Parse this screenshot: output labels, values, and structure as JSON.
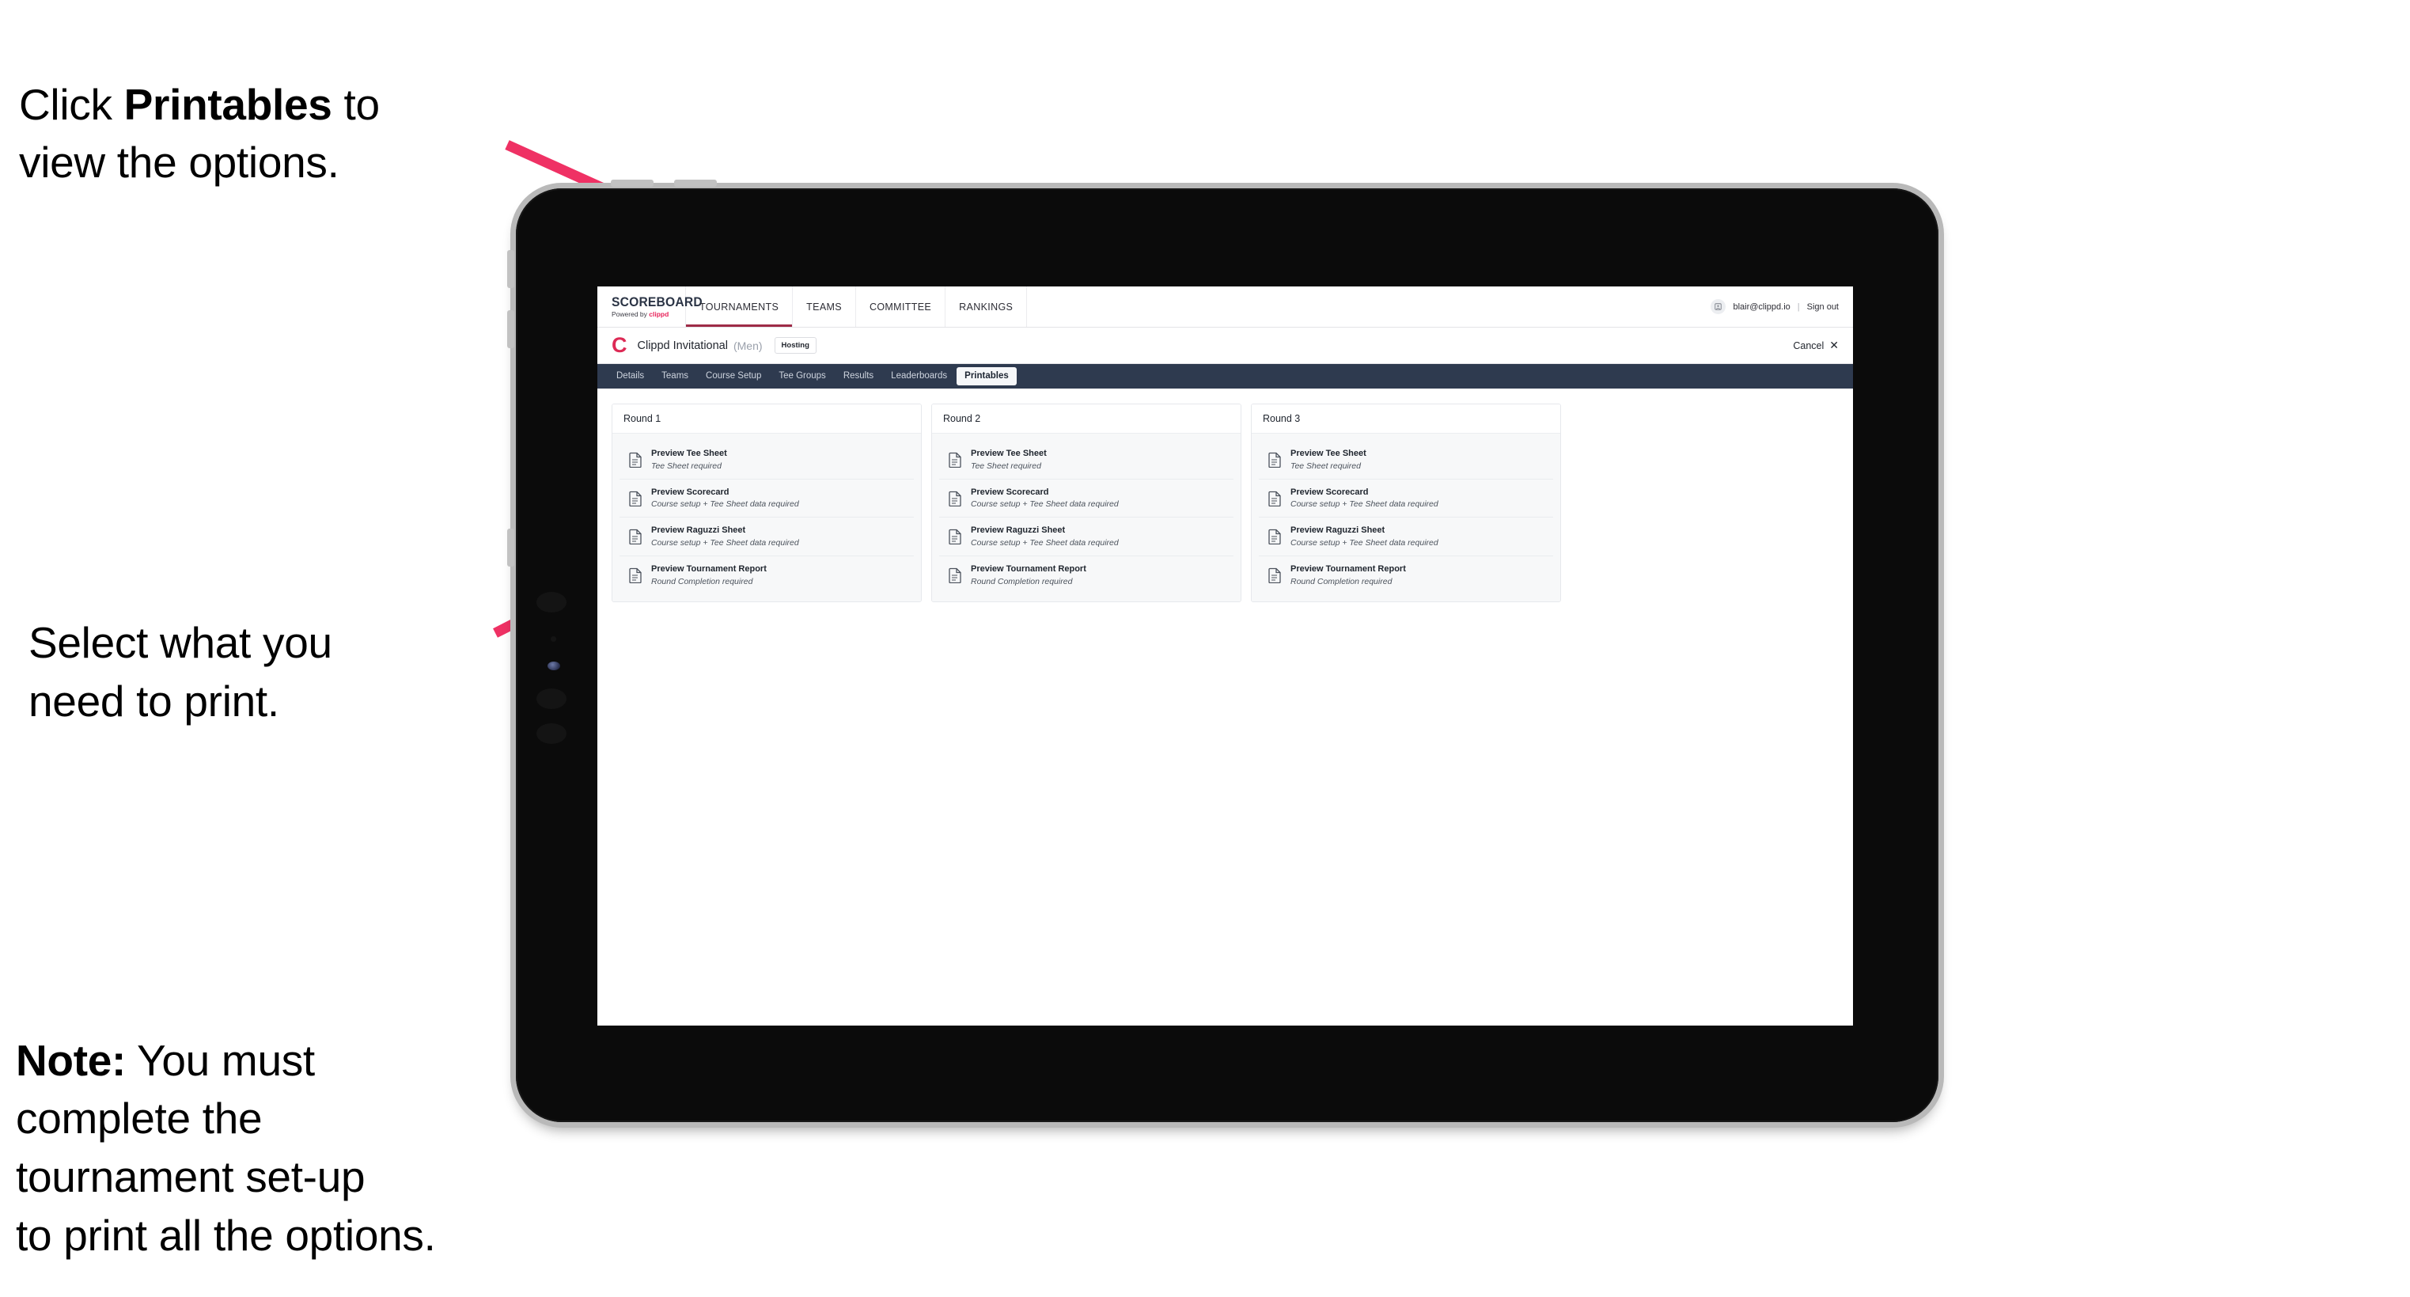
{
  "annotations": {
    "top": {
      "prefix": "Click ",
      "bold": "Printables",
      "suffix": " to\nview the options."
    },
    "middle": {
      "text": "Select what you\n need to print."
    },
    "note": {
      "bold": "Note:",
      "text": " You must\ncomplete the\ntournament set-up\nto print all the options."
    }
  },
  "app": {
    "global_nav": {
      "brand_title": "SCOREBOARD",
      "brand_sub_prefix": "Powered by ",
      "brand_sub_highlight": "clippd",
      "items": [
        {
          "label": "TOURNAMENTS",
          "active": true
        },
        {
          "label": "TEAMS",
          "active": false
        },
        {
          "label": "COMMITTEE",
          "active": false
        },
        {
          "label": "RANKINGS",
          "active": false
        }
      ],
      "avatar_icon": "user-avatar-icon",
      "user_email": "blair@clippd.io",
      "separator": "|",
      "sign_out": "Sign out"
    },
    "tournament_bar": {
      "logo_letter": "C",
      "name": "Clippd Invitational",
      "gender": "(Men)",
      "badge": "Hosting",
      "cancel_label": "Cancel",
      "cancel_icon": "✕"
    },
    "tabs": [
      {
        "label": "Details",
        "active": false
      },
      {
        "label": "Teams",
        "active": false
      },
      {
        "label": "Course Setup",
        "active": false
      },
      {
        "label": "Tee Groups",
        "active": false
      },
      {
        "label": "Results",
        "active": false
      },
      {
        "label": "Leaderboards",
        "active": false
      },
      {
        "label": "Printables",
        "active": true
      }
    ],
    "rounds": [
      {
        "header": "Round 1",
        "items": [
          {
            "title": "Preview Tee Sheet",
            "sub": "Tee Sheet required"
          },
          {
            "title": "Preview Scorecard",
            "sub": "Course setup + Tee Sheet data required"
          },
          {
            "title": "Preview Raguzzi Sheet",
            "sub": "Course setup + Tee Sheet data required"
          },
          {
            "title": "Preview Tournament Report",
            "sub": "Round Completion required"
          }
        ]
      },
      {
        "header": "Round 2",
        "items": [
          {
            "title": "Preview Tee Sheet",
            "sub": "Tee Sheet required"
          },
          {
            "title": "Preview Scorecard",
            "sub": "Course setup + Tee Sheet data required"
          },
          {
            "title": "Preview Raguzzi Sheet",
            "sub": "Course setup + Tee Sheet data required"
          },
          {
            "title": "Preview Tournament Report",
            "sub": "Round Completion required"
          }
        ]
      },
      {
        "header": "Round 3",
        "items": [
          {
            "title": "Preview Tee Sheet",
            "sub": "Tee Sheet required"
          },
          {
            "title": "Preview Scorecard",
            "sub": "Course setup + Tee Sheet data required"
          },
          {
            "title": "Preview Raguzzi Sheet",
            "sub": "Course setup + Tee Sheet data required"
          },
          {
            "title": "Preview Tournament Report",
            "sub": "Round Completion required"
          }
        ]
      }
    ]
  },
  "colors": {
    "accent_pink": "#e8235a",
    "arrow_pink": "#ef3164",
    "tab_bar_navy": "#2e3a4f",
    "nav_active_underline": "#9e2b47"
  }
}
